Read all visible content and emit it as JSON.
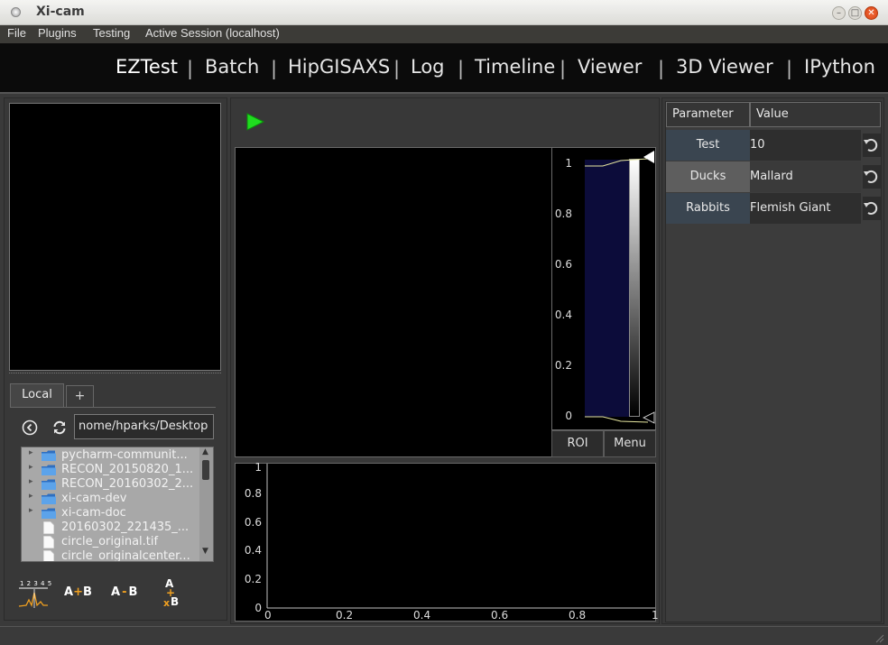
{
  "window": {
    "title": "Xi-cam"
  },
  "menu": [
    "File",
    "Plugins",
    "Testing",
    "Active Session (localhost)"
  ],
  "tabs": [
    {
      "label": "EZTest",
      "active": true
    },
    {
      "label": "Batch"
    },
    {
      "label": "HipGISAXS"
    },
    {
      "label": "Log"
    },
    {
      "label": "Timeline"
    },
    {
      "label": "Viewer"
    },
    {
      "label": "3D Viewer"
    },
    {
      "label": "IPython"
    }
  ],
  "file_browser": {
    "tabs": [
      "Local",
      "+"
    ],
    "path": "nome/hparks/Desktop",
    "items": [
      {
        "name": "pycharm-communit...",
        "type": "folder"
      },
      {
        "name": "RECON_20150820_1...",
        "type": "folder"
      },
      {
        "name": "RECON_20160302_2...",
        "type": "folder"
      },
      {
        "name": "xi-cam-dev",
        "type": "folder"
      },
      {
        "name": "xi-cam-doc",
        "type": "folder"
      },
      {
        "name": "20160302_221435_...",
        "type": "file"
      },
      {
        "name": "circle_original.tif",
        "type": "file"
      },
      {
        "name": "circle_originalcenter...",
        "type": "file"
      }
    ]
  },
  "ops": {
    "peaks_label": "1 2 3 4 5",
    "a_plus_b": {
      "a": "A",
      "op": "+",
      "b": "B"
    },
    "a_minus_b": {
      "a": "A",
      "op": "-",
      "b": "B"
    },
    "stack": {
      "a": "A",
      "plus": "+",
      "x": "x",
      "b": "B"
    }
  },
  "histogram": {
    "ticks": [
      "1",
      "0.8",
      "0.6",
      "0.4",
      "0.2",
      "0"
    ],
    "roi_label": "ROI",
    "menu_label": "Menu"
  },
  "plot": {
    "y_ticks": [
      "1",
      "0.8",
      "0.6",
      "0.4",
      "0.2",
      "0"
    ],
    "x_ticks": [
      "0",
      "0.2",
      "0.4",
      "0.6",
      "0.8",
      "1"
    ]
  },
  "params": {
    "headers": [
      "Parameter",
      "Value"
    ],
    "rows": [
      {
        "name": "Test",
        "value": "10"
      },
      {
        "name": "Ducks",
        "value": "Mallard"
      },
      {
        "name": "Rabbits",
        "value": "Flemish Giant"
      }
    ]
  },
  "colors": {
    "play": "#1fdc1f",
    "accent_orange": "#f0a020",
    "hist_fill": "#0c0c3a"
  }
}
